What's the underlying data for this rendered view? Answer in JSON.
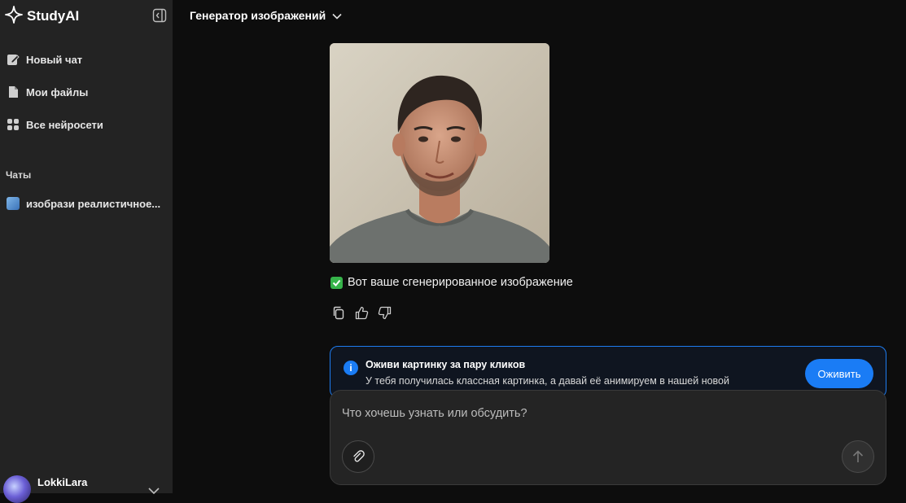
{
  "app": {
    "name": "StudyAI"
  },
  "sidebar": {
    "items": [
      {
        "label": "Новый чат",
        "icon": "edit-icon"
      },
      {
        "label": "Мои файлы",
        "icon": "file-icon"
      },
      {
        "label": "Все нейросети",
        "icon": "grid-icon"
      }
    ],
    "section_label": "Чаты",
    "chats": [
      {
        "label": "изобрази реалистичное..."
      }
    ],
    "user": {
      "name": "LokkiLara"
    }
  },
  "header": {
    "model": "Генератор изображений"
  },
  "message": {
    "image_alt": "Сгенерированный портрет мужчины",
    "result_text": "Вот ваше сгенерированное изображение"
  },
  "banner": {
    "title": "Оживи картинку за пару кликов",
    "text": "У тебя получилась классная картинка, а давай её анимируем в нашей новой",
    "button": "Оживить"
  },
  "composer": {
    "placeholder": "Что хочешь узнать или обсудить?"
  },
  "colors": {
    "accent": "#1a7cf5",
    "sidebar_bg": "#232323",
    "page_bg": "#0d0d0d"
  }
}
